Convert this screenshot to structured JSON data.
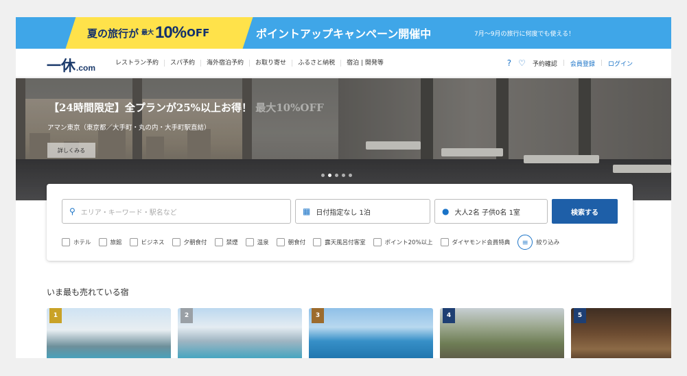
{
  "banner": {
    "lead": "夏の旅行が",
    "max": "最大",
    "percent": "10%",
    "off": "OFF",
    "headline": "ポイントアップキャンペーン開催中",
    "sub": "7月〜9月の旅行に何度でも使える！"
  },
  "header": {
    "logo_mark": "一休",
    "logo_domain": ".com",
    "nav": [
      "レストラン予約",
      "スパ予約",
      "海外宿泊予約",
      "お取り寄せ",
      "ふるさと納税",
      "宿泊 | 開発等"
    ],
    "help_icon": "question-circle-icon",
    "favorite_icon": "heart-icon",
    "reservations": "予約確認",
    "register": "会員登録",
    "login": "ログイン"
  },
  "hero": {
    "title_main": "【24時間限定】全プランが25%以上お得！",
    "title_fade": "最大10%OFF",
    "subtitle": "アマン東京（東京都／大手町・丸の内・大手町駅直結）",
    "button": "詳しくみる",
    "slide_count": 5,
    "active_slide": 2
  },
  "search": {
    "area_placeholder": "エリア・キーワード・駅名など",
    "date_value": "日付指定なし 1泊",
    "people_value": "大人2名 子供0名 1室",
    "submit": "検索する",
    "filters": [
      "ホテル",
      "旅館",
      "ビジネス",
      "夕朝食付",
      "禁煙",
      "温泉",
      "朝食付",
      "露天風呂付客室",
      "ポイント20%以上",
      "ダイヤモンド会員特典"
    ],
    "more_filters": "絞り込み",
    "colors": {
      "accent": "#1e5fa8",
      "link": "#1a73c7"
    }
  },
  "ranking": {
    "title": "いま最も売れている宿",
    "cards": [
      {
        "rank": "1"
      },
      {
        "rank": "2"
      },
      {
        "rank": "3"
      },
      {
        "rank": "4"
      },
      {
        "rank": "5"
      }
    ]
  }
}
